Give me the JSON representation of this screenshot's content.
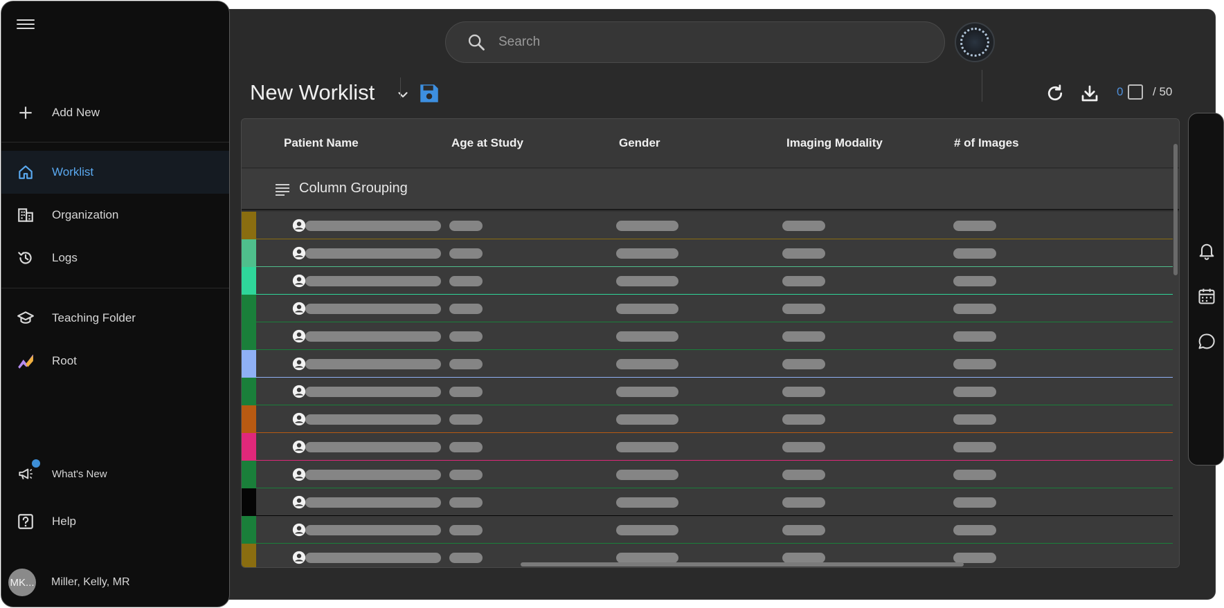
{
  "sidebar": {
    "menu_icon": "hamburger-menu-icon",
    "add_new": "Add New",
    "items": [
      {
        "label": "Worklist",
        "icon": "home-icon",
        "active": true
      },
      {
        "label": "Organization",
        "icon": "organization-icon",
        "active": false
      },
      {
        "label": "Logs",
        "icon": "history-icon",
        "active": false
      },
      {
        "label": "Teaching Folder",
        "icon": "graduation-cap-icon",
        "active": false
      },
      {
        "label": "Root",
        "icon": "root-logo-icon",
        "active": false
      }
    ],
    "whats_new": "What's New",
    "help": "Help",
    "user": {
      "initials": "MK...",
      "name": "Miller, Kelly, MR"
    }
  },
  "search": {
    "placeholder": "Search"
  },
  "worklist": {
    "title": "New Worklist",
    "selected_count": "0",
    "total": "/ 50"
  },
  "table": {
    "columns": [
      "Patient Name",
      "Age at Study",
      "Gender",
      "Imaging Modality",
      "# of Images"
    ],
    "grouping_label": "Column Grouping",
    "row_colors": [
      "#8a6d10",
      "#4fbf8c",
      "#2fd69a",
      "#1a7f3a",
      "#1a7f3a",
      "#8fb0f5",
      "#1a7f3a",
      "#b85a12",
      "#e0287a",
      "#1a7f3a",
      "#050505",
      "#1a7f3a",
      "#8a6d10"
    ]
  },
  "colors": {
    "accent": "#5aa9f0",
    "save": "#3d8fe0",
    "background": "#2a2a2a",
    "sidebar": "#0e0e0e"
  }
}
